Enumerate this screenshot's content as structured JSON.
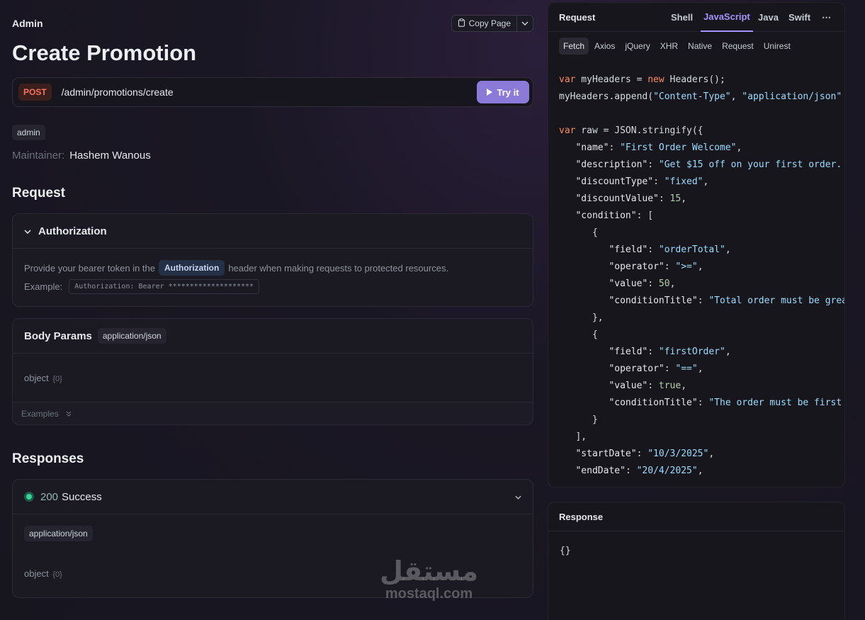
{
  "breadcrumb": "Admin",
  "copy_page_label": "Copy Page",
  "page_title": "Create Promotion",
  "endpoint": {
    "method": "POST",
    "path": "/admin/promotions/create",
    "try_label": "Try it"
  },
  "tag": "admin",
  "maintainer": {
    "label": "Maintainer:",
    "name": "Hashem Wanous"
  },
  "request": {
    "heading": "Request",
    "auth": {
      "title": "Authorization",
      "text_before": "Provide your bearer token in the",
      "header_pill": "Authorization",
      "text_after": "header when making requests to protected resources.",
      "example_label": "Example:",
      "example_value": "Authorization: Bearer ********************"
    },
    "body": {
      "title": "Body Params",
      "content_type": "application/json",
      "object_label": "object",
      "object_count": "{0}",
      "examples_label": "Examples"
    }
  },
  "responses": {
    "heading": "Responses",
    "status_code": "200",
    "status_text": "Success",
    "content_type": "application/json",
    "object_label": "object",
    "object_count": "{0}"
  },
  "code_panel": {
    "title": "Request",
    "langs": [
      "Shell",
      "JavaScript",
      "Java",
      "Swift"
    ],
    "active_lang": "JavaScript",
    "subtabs": [
      "Fetch",
      "Axios",
      "jQuery",
      "XHR",
      "Native",
      "Request",
      "Unirest"
    ],
    "active_subtab": "Fetch"
  },
  "response_panel": {
    "title": "Response",
    "body": "{}"
  },
  "watermark": {
    "arabic": "مستقل",
    "latin": "mostaql.com"
  },
  "colors": {
    "accent": "#a594f9",
    "try_button": "#8b7ad8",
    "post": "#f87160",
    "success": "#34d399"
  }
}
